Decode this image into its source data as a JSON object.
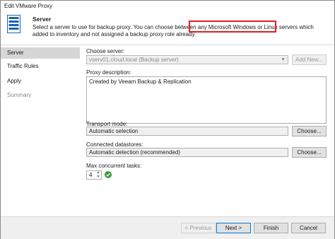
{
  "window": {
    "title": "Edit VMware Proxy"
  },
  "header": {
    "title": "Server",
    "description": "Select a server to use for backup proxy. You can choose between any Microsoft Windows or Linux servers which added to inventory and not assigned a backup proxy role already.",
    "icon": "server-icon",
    "highlight_color": "#e02020"
  },
  "sidebar": {
    "items": [
      {
        "label": "Server",
        "state": "active"
      },
      {
        "label": "Traffic Rules",
        "state": "normal"
      },
      {
        "label": "Apply",
        "state": "normal"
      },
      {
        "label": "Summary",
        "state": "disabled"
      }
    ]
  },
  "form": {
    "choose_server_label": "Choose server:",
    "choose_server_value": "vserv01.cloud.local (Backup server)",
    "add_new_label": "Add New...",
    "description_label": "Proxy description:",
    "description_value": "Created by Veeam Backup & Replication",
    "transport_label": "Transport mode:",
    "transport_value": "Automatic selection",
    "transport_choose_label": "Choose...",
    "datastores_label": "Connected datastores:",
    "datastores_value": "Automatic detection (recommended)",
    "datastores_choose_label": "Choose...",
    "max_tasks_label": "Max concurrent tasks:",
    "max_tasks_value": "4",
    "max_tasks_status_icon": "checkmark-icon"
  },
  "footer": {
    "previous_label": "< Previous",
    "next_label": "Next >",
    "finish_label": "Finish",
    "cancel_label": "Cancel"
  },
  "colors": {
    "accent": "#0078d7",
    "sidebar_active": "#d6d6d6",
    "ok_green": "#3a9a3a"
  }
}
